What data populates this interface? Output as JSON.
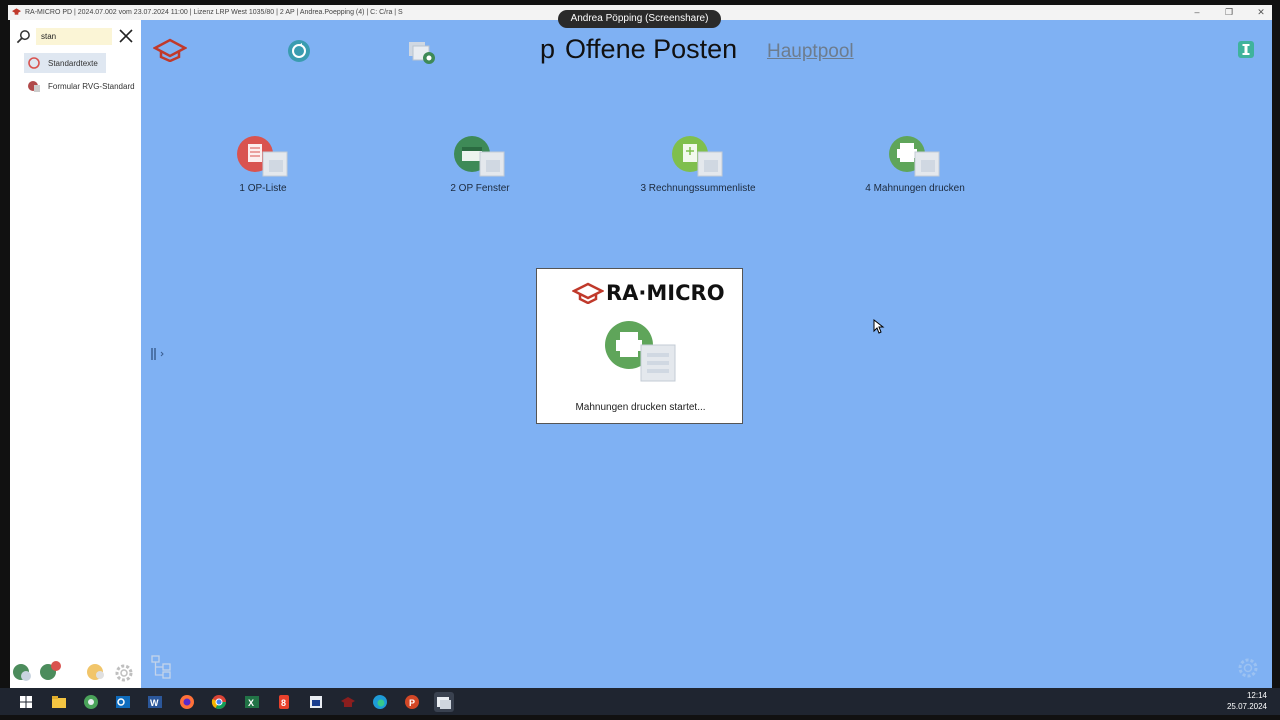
{
  "window": {
    "title": "RA-MICRO PD | 2024.07.002 vom 23.07.2024 11:00 | Lizenz LRP West 1035/80 | 2 AP | Andrea.Poepping (4) | C: C/ra | S",
    "minimize": "–",
    "maximize": "❐",
    "close": "✕"
  },
  "screenshare": {
    "label": "Andrea Pöpping (Screenshare)"
  },
  "sidebar": {
    "search_value": "stan",
    "results": [
      {
        "label": "Standardtexte",
        "icon": "standardtexte-icon"
      },
      {
        "label": "Formular RVG-Standard",
        "icon": "formular-icon"
      }
    ]
  },
  "header": {
    "prefix": "p",
    "title": "Offene Posten",
    "pool": "Hauptpool"
  },
  "tiles": [
    {
      "label": "1  OP-Liste",
      "color": "#d9534f",
      "icon": "op-liste-icon"
    },
    {
      "label": "2  OP Fenster",
      "color": "#3e8a57",
      "icon": "op-fenster-icon"
    },
    {
      "label": "3  Rechnungssummenliste",
      "color": "#7fbf4d",
      "icon": "rechnungssummenliste-icon"
    },
    {
      "label": "4  Mahnungen drucken",
      "color": "#5fa55a",
      "icon": "mahnungen-drucken-icon"
    }
  ],
  "splash": {
    "brand": "RA·MICRO",
    "message": "Mahnungen drucken startet..."
  },
  "taskbar": {
    "time": "12:14",
    "date": "25.07.2024",
    "apps": [
      "windows-start-icon",
      "file-explorer-icon",
      "network-icon",
      "outlook-icon",
      "word-icon",
      "firefox-icon",
      "chrome-icon",
      "excel-icon",
      "app8-icon",
      "app9-icon",
      "app10-icon",
      "edge-icon",
      "powerpoint-icon",
      "ra-micro-icon"
    ]
  }
}
